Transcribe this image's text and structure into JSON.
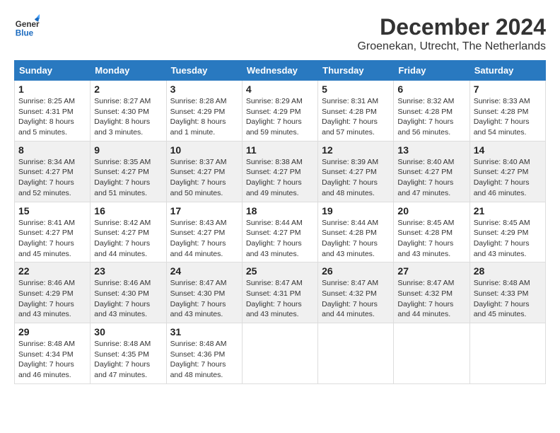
{
  "header": {
    "logo_line1": "General",
    "logo_line2": "Blue",
    "month_title": "December 2024",
    "location": "Groenekan, Utrecht, The Netherlands"
  },
  "days_of_week": [
    "Sunday",
    "Monday",
    "Tuesday",
    "Wednesday",
    "Thursday",
    "Friday",
    "Saturday"
  ],
  "weeks": [
    [
      {
        "day": "1",
        "sunrise": "8:25 AM",
        "sunset": "4:31 PM",
        "daylight": "8 hours and 5 minutes."
      },
      {
        "day": "2",
        "sunrise": "8:27 AM",
        "sunset": "4:30 PM",
        "daylight": "8 hours and 3 minutes."
      },
      {
        "day": "3",
        "sunrise": "8:28 AM",
        "sunset": "4:29 PM",
        "daylight": "8 hours and 1 minute."
      },
      {
        "day": "4",
        "sunrise": "8:29 AM",
        "sunset": "4:29 PM",
        "daylight": "7 hours and 59 minutes."
      },
      {
        "day": "5",
        "sunrise": "8:31 AM",
        "sunset": "4:28 PM",
        "daylight": "7 hours and 57 minutes."
      },
      {
        "day": "6",
        "sunrise": "8:32 AM",
        "sunset": "4:28 PM",
        "daylight": "7 hours and 56 minutes."
      },
      {
        "day": "7",
        "sunrise": "8:33 AM",
        "sunset": "4:28 PM",
        "daylight": "7 hours and 54 minutes."
      }
    ],
    [
      {
        "day": "8",
        "sunrise": "8:34 AM",
        "sunset": "4:27 PM",
        "daylight": "7 hours and 52 minutes."
      },
      {
        "day": "9",
        "sunrise": "8:35 AM",
        "sunset": "4:27 PM",
        "daylight": "7 hours and 51 minutes."
      },
      {
        "day": "10",
        "sunrise": "8:37 AM",
        "sunset": "4:27 PM",
        "daylight": "7 hours and 50 minutes."
      },
      {
        "day": "11",
        "sunrise": "8:38 AM",
        "sunset": "4:27 PM",
        "daylight": "7 hours and 49 minutes."
      },
      {
        "day": "12",
        "sunrise": "8:39 AM",
        "sunset": "4:27 PM",
        "daylight": "7 hours and 48 minutes."
      },
      {
        "day": "13",
        "sunrise": "8:40 AM",
        "sunset": "4:27 PM",
        "daylight": "7 hours and 47 minutes."
      },
      {
        "day": "14",
        "sunrise": "8:40 AM",
        "sunset": "4:27 PM",
        "daylight": "7 hours and 46 minutes."
      }
    ],
    [
      {
        "day": "15",
        "sunrise": "8:41 AM",
        "sunset": "4:27 PM",
        "daylight": "7 hours and 45 minutes."
      },
      {
        "day": "16",
        "sunrise": "8:42 AM",
        "sunset": "4:27 PM",
        "daylight": "7 hours and 44 minutes."
      },
      {
        "day": "17",
        "sunrise": "8:43 AM",
        "sunset": "4:27 PM",
        "daylight": "7 hours and 44 minutes."
      },
      {
        "day": "18",
        "sunrise": "8:44 AM",
        "sunset": "4:27 PM",
        "daylight": "7 hours and 43 minutes."
      },
      {
        "day": "19",
        "sunrise": "8:44 AM",
        "sunset": "4:28 PM",
        "daylight": "7 hours and 43 minutes."
      },
      {
        "day": "20",
        "sunrise": "8:45 AM",
        "sunset": "4:28 PM",
        "daylight": "7 hours and 43 minutes."
      },
      {
        "day": "21",
        "sunrise": "8:45 AM",
        "sunset": "4:29 PM",
        "daylight": "7 hours and 43 minutes."
      }
    ],
    [
      {
        "day": "22",
        "sunrise": "8:46 AM",
        "sunset": "4:29 PM",
        "daylight": "7 hours and 43 minutes."
      },
      {
        "day": "23",
        "sunrise": "8:46 AM",
        "sunset": "4:30 PM",
        "daylight": "7 hours and 43 minutes."
      },
      {
        "day": "24",
        "sunrise": "8:47 AM",
        "sunset": "4:30 PM",
        "daylight": "7 hours and 43 minutes."
      },
      {
        "day": "25",
        "sunrise": "8:47 AM",
        "sunset": "4:31 PM",
        "daylight": "7 hours and 43 minutes."
      },
      {
        "day": "26",
        "sunrise": "8:47 AM",
        "sunset": "4:32 PM",
        "daylight": "7 hours and 44 minutes."
      },
      {
        "day": "27",
        "sunrise": "8:47 AM",
        "sunset": "4:32 PM",
        "daylight": "7 hours and 44 minutes."
      },
      {
        "day": "28",
        "sunrise": "8:48 AM",
        "sunset": "4:33 PM",
        "daylight": "7 hours and 45 minutes."
      }
    ],
    [
      {
        "day": "29",
        "sunrise": "8:48 AM",
        "sunset": "4:34 PM",
        "daylight": "7 hours and 46 minutes."
      },
      {
        "day": "30",
        "sunrise": "8:48 AM",
        "sunset": "4:35 PM",
        "daylight": "7 hours and 47 minutes."
      },
      {
        "day": "31",
        "sunrise": "8:48 AM",
        "sunset": "4:36 PM",
        "daylight": "7 hours and 48 minutes."
      },
      null,
      null,
      null,
      null
    ]
  ],
  "labels": {
    "sunrise": "Sunrise:",
    "sunset": "Sunset:",
    "daylight": "Daylight:"
  }
}
